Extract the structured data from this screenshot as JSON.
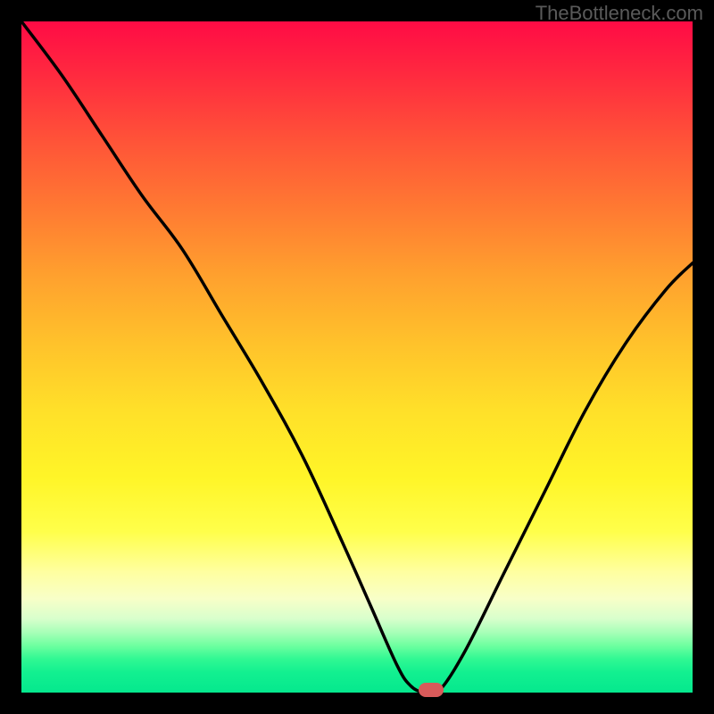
{
  "watermark": "TheBottleneck.com",
  "chart_data": {
    "type": "line",
    "title": "",
    "xlabel": "",
    "ylabel": "",
    "xlim": [
      0,
      100
    ],
    "ylim": [
      0,
      100
    ],
    "gradient_stops": [
      {
        "pos": 0,
        "color": "#ff0b45"
      },
      {
        "pos": 18,
        "color": "#ff5438"
      },
      {
        "pos": 38,
        "color": "#ffa12e"
      },
      {
        "pos": 58,
        "color": "#ffe029"
      },
      {
        "pos": 76,
        "color": "#ffff4a"
      },
      {
        "pos": 90,
        "color": "#b8ffc0"
      },
      {
        "pos": 100,
        "color": "#05e88e"
      }
    ],
    "series": [
      {
        "name": "bottleneck-curve",
        "x": [
          0,
          6,
          12,
          18,
          24,
          30,
          36,
          42,
          48,
          52,
          56,
          58,
          60,
          62,
          66,
          72,
          78,
          84,
          90,
          96,
          100
        ],
        "y": [
          100,
          92,
          83,
          74,
          66,
          56,
          46,
          35,
          22,
          13,
          4,
          1,
          0,
          0,
          6,
          18,
          30,
          42,
          52,
          60,
          64
        ]
      }
    ],
    "marker": {
      "x": 61,
      "y": 0,
      "color": "#d85a5a"
    }
  }
}
